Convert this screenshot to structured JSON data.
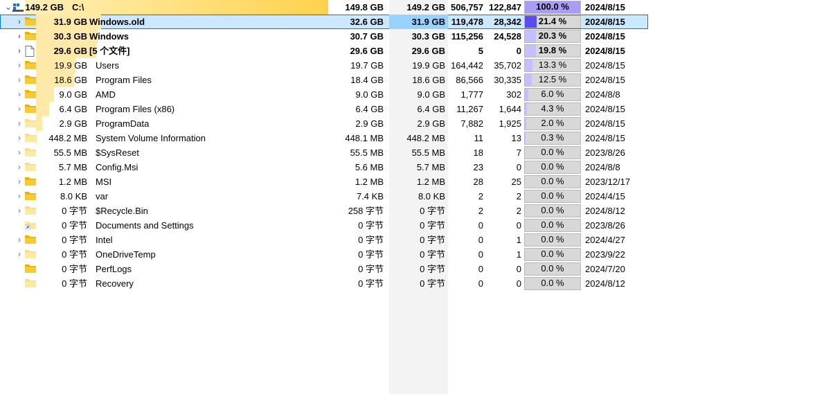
{
  "colors": {
    "size_bar": "#ffe9a8",
    "size_bar_root": "#ffd24d",
    "pct_fill": "#c4c0ff",
    "pct_fill_root": "#a89cf5",
    "pct_fill_selected": "#5a4cf0",
    "folder": "#e8b400",
    "selected_bg": "#cce8ff"
  },
  "root": {
    "size": "149.2 GB",
    "name": "C:\\",
    "c1": "149.8 GB",
    "c2": "149.2 GB",
    "c3": "506,757",
    "c4": "122,847",
    "pct": "100.0 %",
    "pct_value": 100.0,
    "date": "2024/8/15"
  },
  "rows": [
    {
      "size": "31.9 GB",
      "name": "Windows.old",
      "c1": "32.6 GB",
      "c2": "31.9 GB",
      "c3": "119,478",
      "c4": "28,342",
      "pct": "21.4 %",
      "pct_value": 21.4,
      "date": "2024/8/15",
      "icon": "folder-icon",
      "expandable": true,
      "bold": true,
      "selected": true
    },
    {
      "size": "30.3 GB",
      "name": "Windows",
      "c1": "30.7 GB",
      "c2": "30.3 GB",
      "c3": "115,256",
      "c4": "24,528",
      "pct": "20.3 %",
      "pct_value": 20.3,
      "date": "2024/8/15",
      "icon": "folder-icon",
      "expandable": true,
      "bold": true,
      "selected": false
    },
    {
      "size": "29.6 GB",
      "name": "[5 个文件]",
      "c1": "29.6 GB",
      "c2": "29.6 GB",
      "c3": "5",
      "c4": "0",
      "pct": "19.8 %",
      "pct_value": 19.8,
      "date": "2024/8/15",
      "icon": "file-icon",
      "expandable": true,
      "bold": true,
      "selected": false
    },
    {
      "size": "19.9 GB",
      "name": "Users",
      "c1": "19.7 GB",
      "c2": "19.9 GB",
      "c3": "164,442",
      "c4": "35,702",
      "pct": "13.3 %",
      "pct_value": 13.3,
      "date": "2024/8/15",
      "icon": "folder-icon",
      "expandable": true,
      "bold": false,
      "selected": false
    },
    {
      "size": "18.6 GB",
      "name": "Program Files",
      "c1": "18.4 GB",
      "c2": "18.6 GB",
      "c3": "86,566",
      "c4": "30,335",
      "pct": "12.5 %",
      "pct_value": 12.5,
      "date": "2024/8/15",
      "icon": "folder-icon",
      "expandable": true,
      "bold": false,
      "selected": false
    },
    {
      "size": "9.0 GB",
      "name": "AMD",
      "c1": "9.0 GB",
      "c2": "9.0 GB",
      "c3": "1,777",
      "c4": "302",
      "pct": "6.0 %",
      "pct_value": 6.0,
      "date": "2024/8/8",
      "icon": "folder-icon",
      "expandable": true,
      "bold": false,
      "selected": false
    },
    {
      "size": "6.4 GB",
      "name": "Program Files (x86)",
      "c1": "6.4 GB",
      "c2": "6.4 GB",
      "c3": "11,267",
      "c4": "1,644",
      "pct": "4.3 %",
      "pct_value": 4.3,
      "date": "2024/8/15",
      "icon": "folder-icon",
      "expandable": true,
      "bold": false,
      "selected": false
    },
    {
      "size": "2.9 GB",
      "name": "ProgramData",
      "c1": "2.9 GB",
      "c2": "2.9 GB",
      "c3": "7,882",
      "c4": "1,925",
      "pct": "2.0 %",
      "pct_value": 2.0,
      "date": "2024/8/15",
      "icon": "folder-icon-light",
      "expandable": true,
      "bold": false,
      "selected": false
    },
    {
      "size": "448.2 MB",
      "name": "System Volume Information",
      "c1": "448.1 MB",
      "c2": "448.2 MB",
      "c3": "11",
      "c4": "13",
      "pct": "0.3 %",
      "pct_value": 0.3,
      "date": "2024/8/15",
      "icon": "folder-icon-light",
      "expandable": true,
      "bold": false,
      "selected": false
    },
    {
      "size": "55.5 MB",
      "name": "$SysReset",
      "c1": "55.5 MB",
      "c2": "55.5 MB",
      "c3": "18",
      "c4": "7",
      "pct": "0.0 %",
      "pct_value": 0.0,
      "date": "2023/8/26",
      "icon": "folder-icon-light",
      "expandable": true,
      "bold": false,
      "selected": false
    },
    {
      "size": "5.7 MB",
      "name": "Config.Msi",
      "c1": "5.6 MB",
      "c2": "5.7 MB",
      "c3": "23",
      "c4": "0",
      "pct": "0.0 %",
      "pct_value": 0.0,
      "date": "2024/8/8",
      "icon": "folder-icon-light",
      "expandable": true,
      "bold": false,
      "selected": false
    },
    {
      "size": "1.2 MB",
      "name": "MSI",
      "c1": "1.2 MB",
      "c2": "1.2 MB",
      "c3": "28",
      "c4": "25",
      "pct": "0.0 %",
      "pct_value": 0.0,
      "date": "2023/12/17",
      "icon": "folder-icon",
      "expandable": true,
      "bold": false,
      "selected": false
    },
    {
      "size": "8.0 KB",
      "name": "var",
      "c1": "7.4 KB",
      "c2": "8.0 KB",
      "c3": "2",
      "c4": "2",
      "pct": "0.0 %",
      "pct_value": 0.0,
      "date": "2024/4/15",
      "icon": "folder-icon",
      "expandable": true,
      "bold": false,
      "selected": false
    },
    {
      "size": "0 字节",
      "name": "$Recycle.Bin",
      "c1": "258 字节",
      "c2": "0 字节",
      "c3": "2",
      "c4": "2",
      "pct": "0.0 %",
      "pct_value": 0.0,
      "date": "2024/8/12",
      "icon": "folder-icon-light",
      "expandable": true,
      "bold": false,
      "selected": false
    },
    {
      "size": "0 字节",
      "name": "Documents and Settings",
      "c1": "0 字节",
      "c2": "0 字节",
      "c3": "0",
      "c4": "0",
      "pct": "0.0 %",
      "pct_value": 0.0,
      "date": "2023/8/26",
      "icon": "shortcut-folder-icon",
      "expandable": false,
      "bold": false,
      "selected": false
    },
    {
      "size": "0 字节",
      "name": "Intel",
      "c1": "0 字节",
      "c2": "0 字节",
      "c3": "0",
      "c4": "1",
      "pct": "0.0 %",
      "pct_value": 0.0,
      "date": "2024/4/27",
      "icon": "folder-icon",
      "expandable": true,
      "bold": false,
      "selected": false
    },
    {
      "size": "0 字节",
      "name": "OneDriveTemp",
      "c1": "0 字节",
      "c2": "0 字节",
      "c3": "0",
      "c4": "1",
      "pct": "0.0 %",
      "pct_value": 0.0,
      "date": "2023/9/22",
      "icon": "folder-icon-light",
      "expandable": true,
      "bold": false,
      "selected": false
    },
    {
      "size": "0 字节",
      "name": "PerfLogs",
      "c1": "0 字节",
      "c2": "0 字节",
      "c3": "0",
      "c4": "0",
      "pct": "0.0 %",
      "pct_value": 0.0,
      "date": "2024/7/20",
      "icon": "folder-icon",
      "expandable": false,
      "bold": false,
      "selected": false
    },
    {
      "size": "0 字节",
      "name": "Recovery",
      "c1": "0 字节",
      "c2": "0 字节",
      "c3": "0",
      "c4": "0",
      "pct": "0.0 %",
      "pct_value": 0.0,
      "date": "2024/8/12",
      "icon": "folder-icon-light",
      "expandable": false,
      "bold": false,
      "selected": false
    }
  ]
}
